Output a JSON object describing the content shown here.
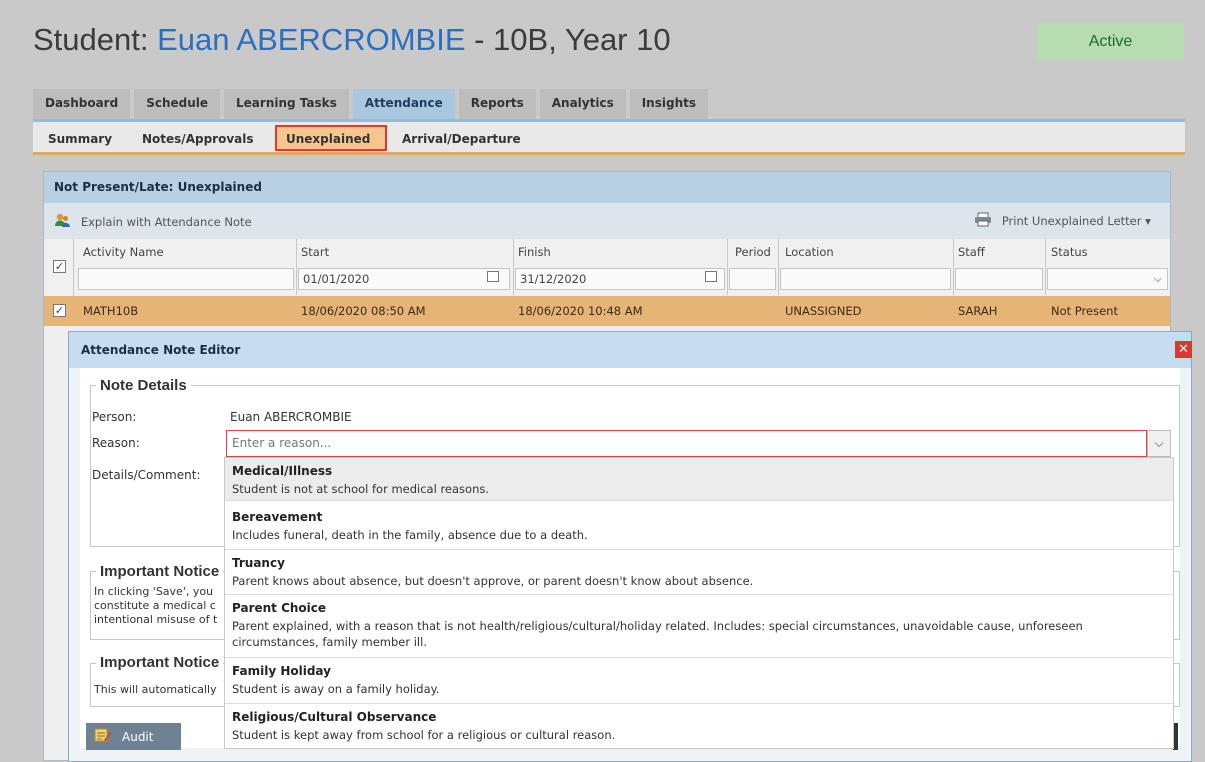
{
  "header": {
    "prefix": "Student: ",
    "student_name": "Euan ABERCROMBIE",
    "suffix": " - 10B, Year 10",
    "status": "Active"
  },
  "main_tabs": [
    "Dashboard",
    "Schedule",
    "Learning Tasks",
    "Attendance",
    "Reports",
    "Analytics",
    "Insights"
  ],
  "active_main_tab": "Attendance",
  "sub_tabs": [
    "Summary",
    "Notes/Approvals",
    "Unexplained",
    "Arrival/Departure"
  ],
  "active_sub_tab": "Unexplained",
  "panel": {
    "title": "Not Present/Late: Unexplained",
    "explain_button": "Explain with Attendance Note",
    "print_button": "Print Unexplained Letter ▾"
  },
  "table": {
    "columns": [
      "Activity Name",
      "Start",
      "Finish",
      "Period",
      "Location",
      "Staff",
      "Status"
    ],
    "filters": {
      "start": "01/01/2020",
      "finish": "31/12/2020"
    },
    "rows": [
      {
        "activity": "MATH10B",
        "start": "18/06/2020 08:50 AM",
        "finish": "18/06/2020 10:48 AM",
        "period": "",
        "location": "UNASSIGNED",
        "staff": "SARAH",
        "status": "Not Present"
      }
    ]
  },
  "modal": {
    "title": "Attendance Note Editor",
    "note_details_legend": "Note Details",
    "person_label": "Person:",
    "person_value": "Euan ABERCROMBIE",
    "reason_label": "Reason:",
    "reason_placeholder": "Enter a reason...",
    "details_label": "Details/Comment:",
    "notice1_legend": "Important Notice",
    "notice1_lines": [
      "In clicking 'Save', you",
      "constitute a medical c",
      "intentional misuse of t"
    ],
    "notice2_legend": "Important Notice",
    "notice2_text": "This will automatically",
    "audit_label": "Audit"
  },
  "reason_options": [
    {
      "title": "Medical/Illness",
      "desc": "Student is not at school for medical reasons."
    },
    {
      "title": "Bereavement",
      "desc": "Includes funeral, death in the family, absence due to a death."
    },
    {
      "title": "Truancy",
      "desc": "Parent knows about absence, but doesn't approve, or parent doesn't know about absence."
    },
    {
      "title": "Parent Choice",
      "desc": "Parent explained, with a reason that is not health/religious/cultural/holiday related. Includes: special circumstances, unavoidable cause, unforeseen circumstances, family member ill."
    },
    {
      "title": "Family Holiday",
      "desc": "Student is away on a family holiday."
    },
    {
      "title": "Religious/Cultural Observance",
      "desc": "Student is kept away from school for a religious or cultural reason."
    }
  ],
  "colors": {
    "accent": "#2c6fbf",
    "active_badge": "#b8dcb1",
    "selected_row": "#e6b477",
    "highlight_border": "#e2382f"
  }
}
